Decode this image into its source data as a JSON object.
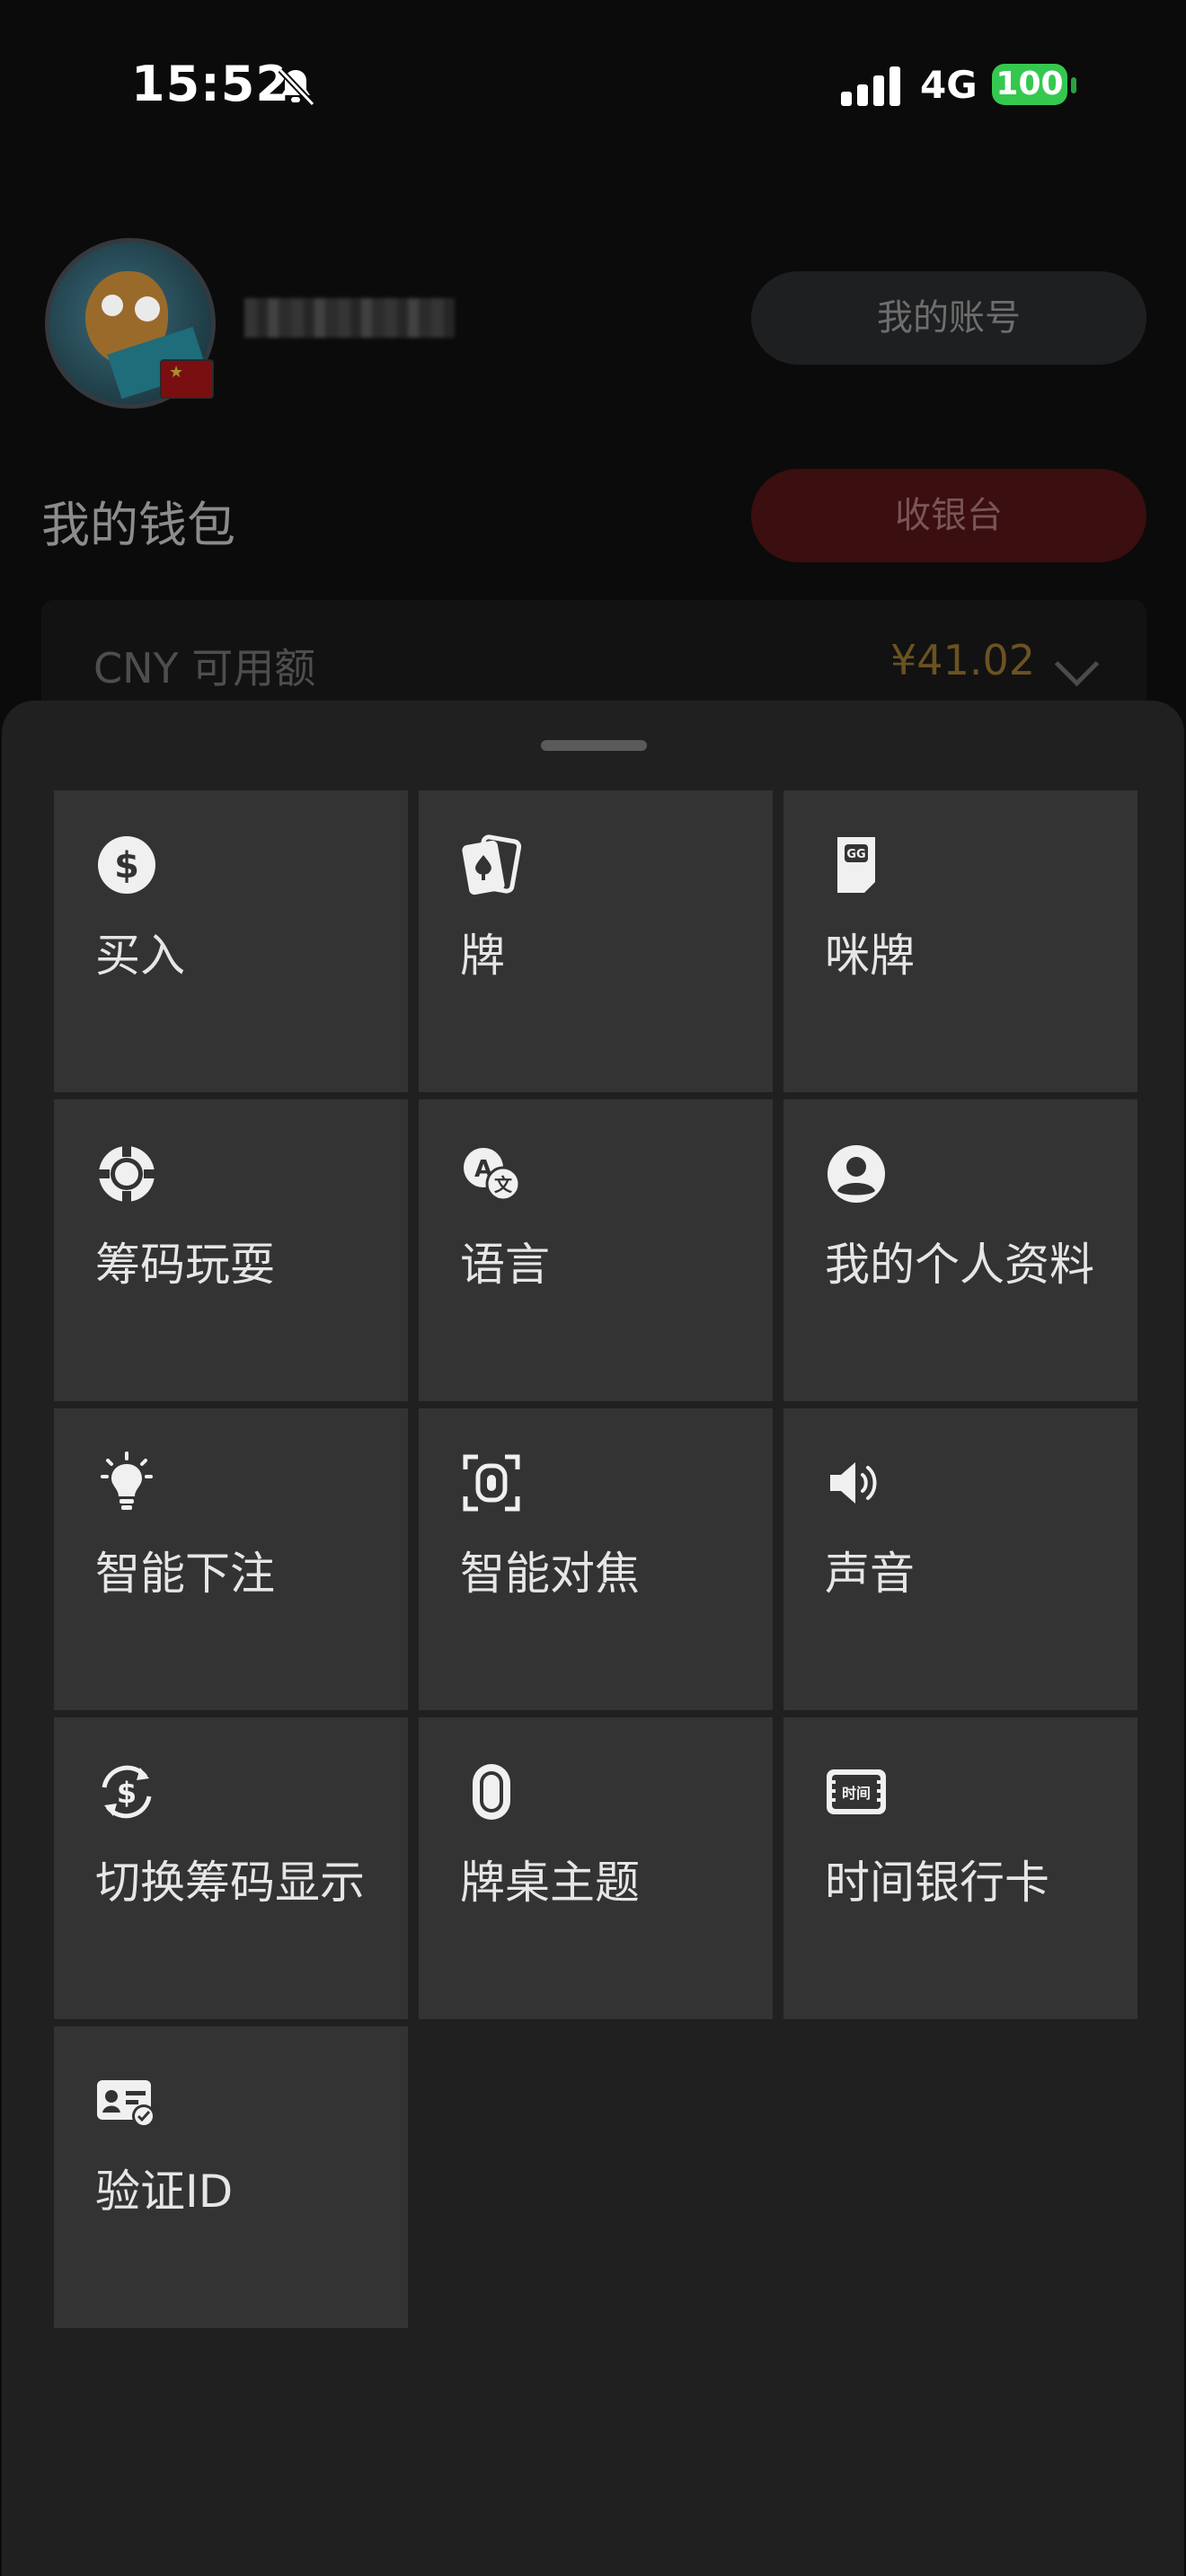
{
  "status_bar": {
    "time": "15:52",
    "network": "4G",
    "battery": "100"
  },
  "profile": {
    "account_button": "我的账号"
  },
  "wallet": {
    "title": "我的钱包",
    "cashier_button": "收银台",
    "currency_label": "CNY 可用额",
    "amount": "¥41.02"
  },
  "menu": {
    "items": [
      {
        "label": "买入",
        "icon": "dollar-coin-icon"
      },
      {
        "label": "牌",
        "icon": "playing-cards-icon"
      },
      {
        "label": "咪牌",
        "icon": "gg-card-icon"
      },
      {
        "label": "筹码玩耍",
        "icon": "poker-chip-icon"
      },
      {
        "label": "语言",
        "icon": "translate-icon"
      },
      {
        "label": "我的个人资料",
        "icon": "user-profile-icon"
      },
      {
        "label": "智能下注",
        "icon": "lightbulb-icon"
      },
      {
        "label": "智能对焦",
        "icon": "focus-frame-icon"
      },
      {
        "label": "声音",
        "icon": "speaker-icon"
      },
      {
        "label": "切换筹码显示",
        "icon": "switch-currency-icon"
      },
      {
        "label": "牌桌主题",
        "icon": "table-theme-icon"
      },
      {
        "label": "时间银行卡",
        "icon": "time-bank-card-icon"
      },
      {
        "label": "验证ID",
        "icon": "verify-id-icon"
      }
    ],
    "time_card_icon_text": "时间"
  },
  "colors": {
    "tile_bg": "#333333",
    "sheet_bg": "#202020",
    "battery_green": "#35c84f",
    "cashier_red": "#3b0e10",
    "amount_gold": "#6b5222"
  }
}
